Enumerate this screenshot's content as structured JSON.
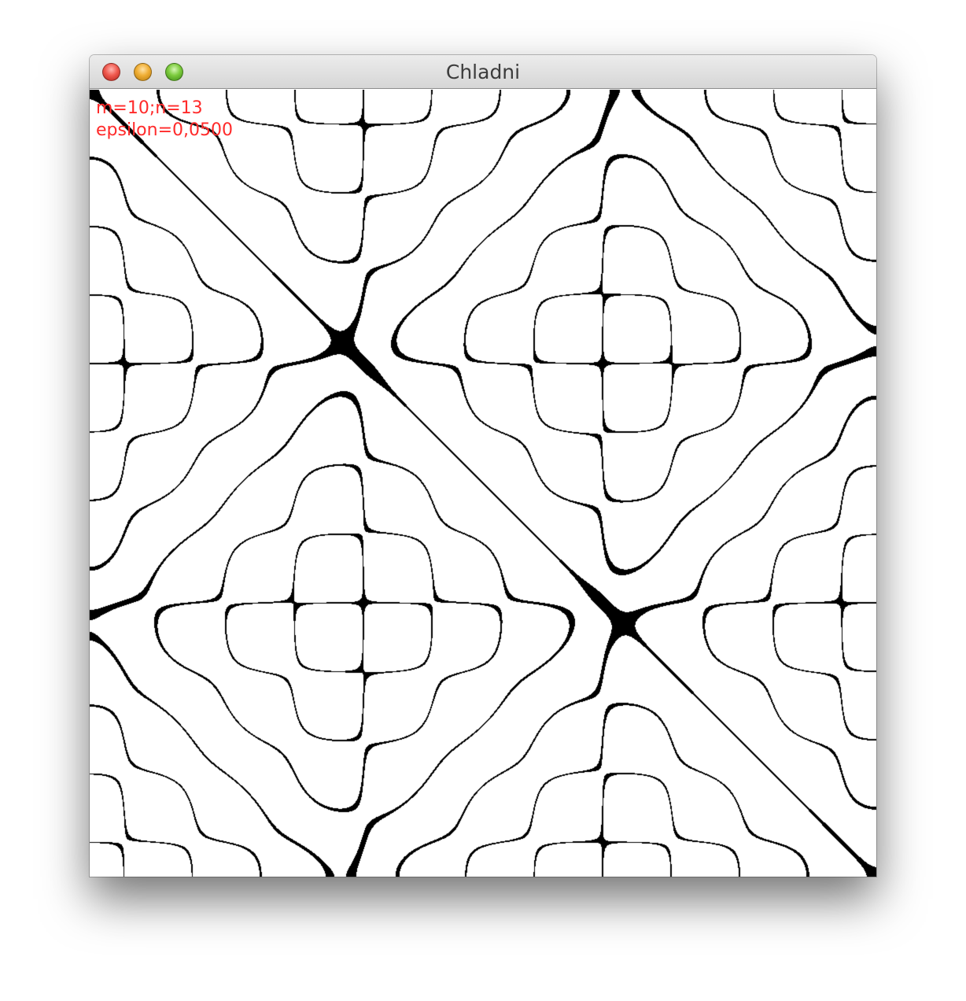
{
  "window": {
    "title": "Chladni"
  },
  "overlay": {
    "params": "m=10;n=13",
    "epsilon": "epsilon=0,0500"
  },
  "plate": {
    "m": 10,
    "n": 13,
    "epsilon": 0.05,
    "ink_color": "#000000",
    "background_color": "#ffffff",
    "text_color": "#ff2a2a"
  },
  "icons": {
    "close": "red-close-button",
    "minimize": "yellow-minimize-button",
    "zoom": "green-zoom-button"
  }
}
